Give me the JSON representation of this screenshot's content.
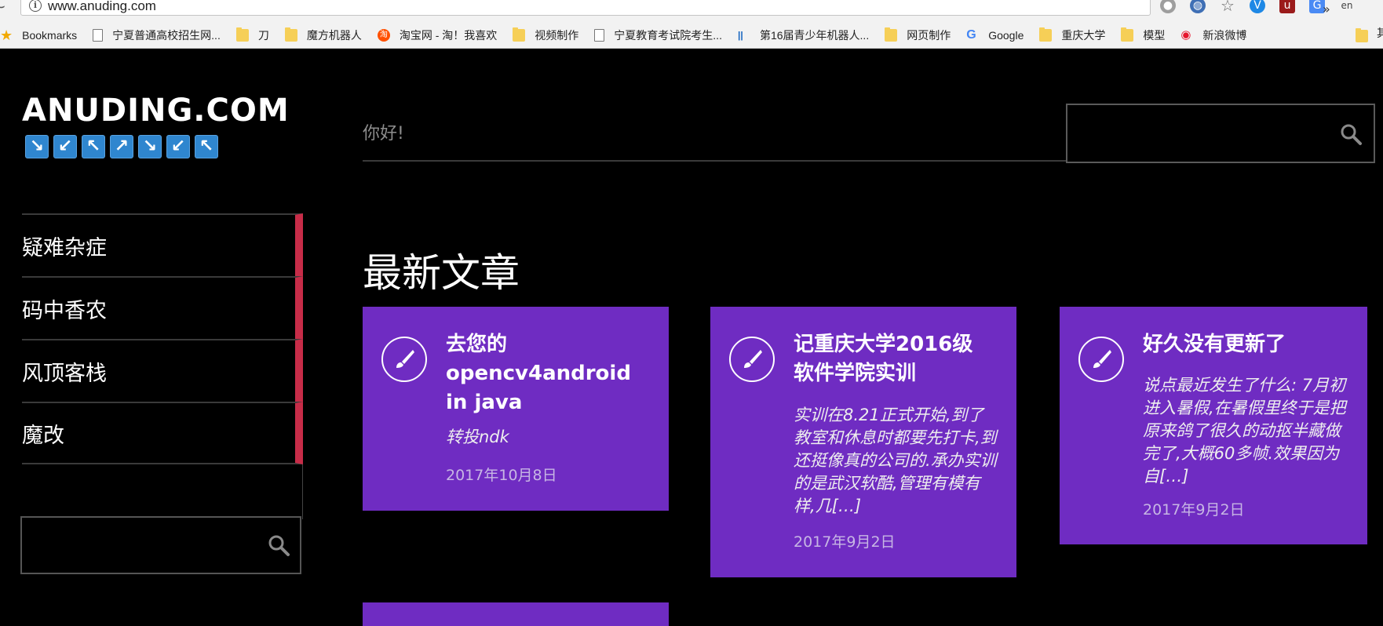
{
  "browser": {
    "url": "www.anuding.com",
    "reload_glyph": "C",
    "bookmarks": [
      {
        "label": "Bookmarks",
        "icon": "star-icon"
      },
      {
        "label": "宁夏普通高校招生网...",
        "icon": "page-icon"
      },
      {
        "label": "刀",
        "icon": "folder-icon"
      },
      {
        "label": "魔方机器人",
        "icon": "folder-icon"
      },
      {
        "label": "淘宝网 - 淘！我喜欢",
        "icon": "taobao-icon"
      },
      {
        "label": "视频制作",
        "icon": "folder-icon"
      },
      {
        "label": "宁夏教育考试院考生...",
        "icon": "page-icon"
      },
      {
        "label": "第16届青少年机器人...",
        "icon": "nineteen-icon"
      },
      {
        "label": "网页制作",
        "icon": "folder-icon"
      },
      {
        "label": "Google",
        "icon": "google-icon"
      },
      {
        "label": "重庆大学",
        "icon": "folder-icon"
      },
      {
        "label": "模型",
        "icon": "folder-icon"
      },
      {
        "label": "新浪微博",
        "icon": "weibo-icon"
      }
    ],
    "more_glyph": "»",
    "tail_label": "其"
  },
  "site": {
    "logo": "ANUDING.COM",
    "arrows": [
      "↘",
      "↙",
      "↖",
      "↗",
      "↘",
      "↙",
      "↖"
    ],
    "greeting": "你好!",
    "nav": [
      "疑难杂症",
      "码中香农",
      "风顶客栈",
      "魔改"
    ],
    "section_title": "最新文章",
    "accent_color": "#6f2cc2",
    "nav_accent_color": "#c72c48",
    "posts": [
      {
        "title": "去您的opencv4android in java",
        "excerpt": "转投ndk",
        "date": "2017年10月8日"
      },
      {
        "title": "记重庆大学2016级软件学院实训",
        "excerpt": "实训在8.21正式开始,到了教室和休息时都要先打卡,到还挺像真的公司的.承办实训的是武汉软酷,管理有模有样,几[…]",
        "date": "2017年9月2日"
      },
      {
        "title": "好久没有更新了",
        "excerpt": "说点最近发生了什么: 7月初进入暑假,在暑假里终于是把原来鸽了很久的动抠半藏做完了,大概60多帧.效果因为自[…]",
        "date": "2017年9月2日"
      }
    ]
  }
}
